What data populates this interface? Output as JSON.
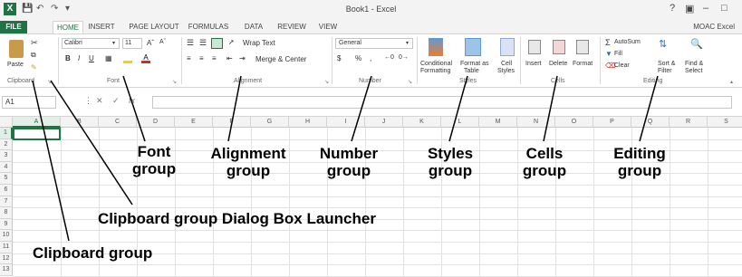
{
  "window": {
    "title": "Book1 - Excel",
    "app_icon": "X",
    "controls": [
      "?",
      "▣",
      "–",
      "□"
    ]
  },
  "tabs": [
    {
      "label": "FILE"
    },
    {
      "label": "HOME"
    },
    {
      "label": "INSERT"
    },
    {
      "label": "PAGE LAYOUT"
    },
    {
      "label": "FORMULAS"
    },
    {
      "label": "DATA"
    },
    {
      "label": "REVIEW"
    },
    {
      "label": "VIEW"
    }
  ],
  "account": "MOAC Excel",
  "ribbon": {
    "clipboard": {
      "paste": "Paste",
      "label": "Clipboard"
    },
    "font": {
      "name": "Calibri",
      "size": "11",
      "label": "Font",
      "bold": "B",
      "italic": "I",
      "underline": "U"
    },
    "alignment": {
      "wrap": "Wrap Text",
      "merge": "Merge & Center",
      "label": "Alignment"
    },
    "number": {
      "format": "General",
      "currency": "$",
      "percent": "%",
      "comma": ",",
      "label": "Number"
    },
    "styles": {
      "conditional": "Conditional",
      "conditional2": "Formatting",
      "format_as": "Format as",
      "format_as2": "Table",
      "cell": "Cell",
      "cell2": "Styles",
      "label": "Styles"
    },
    "cells": {
      "insert": "Insert",
      "delete": "Delete",
      "format": "Format",
      "label": "Cells"
    },
    "editing": {
      "autosum": "AutoSum",
      "fill": "Fill",
      "clear": "Clear",
      "sort": "Sort &",
      "sort2": "Filter",
      "find": "Find &",
      "find2": "Select",
      "label": "Editing"
    }
  },
  "formula_bar": {
    "namebox": "A1",
    "fx": "fx"
  },
  "columns": [
    "A",
    "B",
    "C",
    "D",
    "E",
    "F",
    "G",
    "H",
    "I",
    "J",
    "K",
    "L",
    "M",
    "N",
    "O",
    "P",
    "Q",
    "R",
    "S"
  ],
  "rows": [
    "1",
    "2",
    "3",
    "4",
    "5",
    "6",
    "7",
    "8",
    "9",
    "10",
    "11",
    "12",
    "13"
  ],
  "callouts": {
    "font_group": "Font group",
    "alignment_group": "Alignment group",
    "number_group": "Number group",
    "styles_group": "Styles group",
    "cells_group": "Cells group",
    "editing_group": "Editing group",
    "launcher": "Clipboard group Dialog Box Launcher",
    "clipboard_group": "Clipboard group"
  }
}
